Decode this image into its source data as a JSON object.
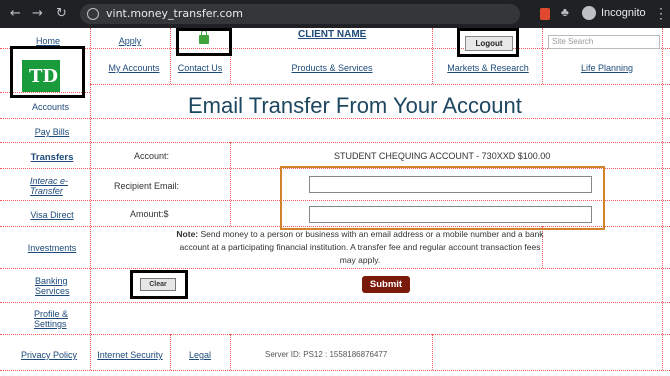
{
  "browser": {
    "url": "vint.money_transfer.com",
    "incognito_label": "Incognito",
    "back_icon": "arrow-left-icon",
    "forward_icon": "arrow-right-icon",
    "reload_icon": "reload-icon"
  },
  "header": {
    "home": "Home",
    "apply": "Apply",
    "client_name": "CLIENT NAME",
    "logout": "Logout",
    "search_placeholder": "Site Search",
    "logo_text": "TD"
  },
  "topnav": {
    "my_accounts": "My Accounts",
    "contact_us": "Contact Us",
    "products_services": "Products & Services",
    "markets_research": "Markets & Research",
    "life_planning": "Life Planning"
  },
  "sidebar": {
    "accounts": "Accounts",
    "pay_bills": "Pay Bills",
    "transfers": "Transfers",
    "interac_line1": "Interac e-",
    "interac_line2": "Transfer",
    "visa_direct": "Visa Direct",
    "investments": "Investments",
    "banking_line1": "Banking",
    "banking_line2": "Services",
    "profile_line1": "Profile &",
    "profile_line2": "Settings"
  },
  "main": {
    "title": "Email Transfer From Your Account",
    "account_label": "Account:",
    "account_value": "STUDENT CHEQUING ACCOUNT - 730XXD $100.00",
    "recipient_label": "Recipient Email:",
    "recipient_value": "",
    "amount_label": "Amount:$",
    "amount_value": "",
    "note_bold": "Note:",
    "note_text": " Send money to a person or business with an email address or a mobile number and a bank account at a participating financial institution. A transfer fee and regular account transaction fees may apply.",
    "clear": "Clear",
    "submit": "Submit"
  },
  "footer": {
    "privacy": "Privacy Policy",
    "security": "Internet Security",
    "legal": "Legal",
    "server_id": "Server ID: PS12 : 1558186876477"
  },
  "colors": {
    "logo_green": "#1a9b3b",
    "submit_bg": "#7a1a0a",
    "title_color": "#1d4660",
    "highlight_orange": "#d4822a",
    "grid_red": "#ee5a5a"
  }
}
